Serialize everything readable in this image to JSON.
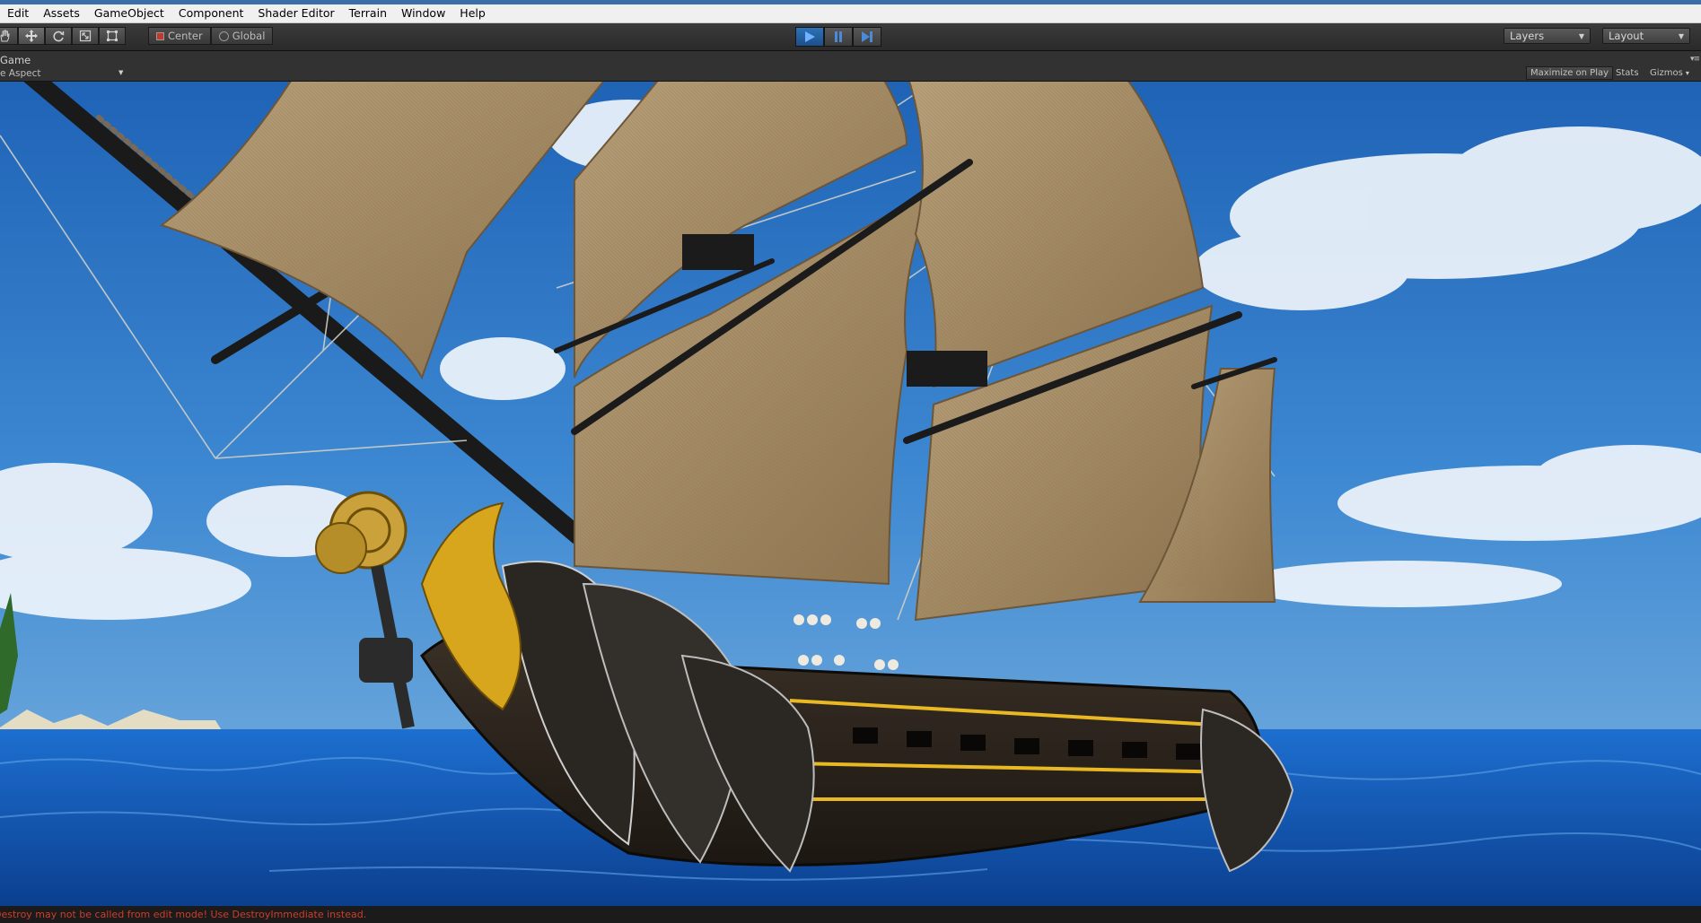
{
  "menubar": {
    "items": [
      "Edit",
      "Assets",
      "GameObject",
      "Component",
      "Shader Editor",
      "Terrain",
      "Window",
      "Help"
    ]
  },
  "toolbar": {
    "transform_tools": [
      "hand-icon",
      "move-icon",
      "rotate-icon",
      "scale-icon",
      "rect-icon"
    ],
    "pivot_mode_label": "Center",
    "pivot_rotation_label": "Global",
    "play_state": "playing",
    "layers_label": "Layers",
    "layout_label": "Layout"
  },
  "game_view": {
    "tab_title": "Game",
    "aspect_label": "e Aspect",
    "maximize_label": "Maximize on Play",
    "stats_label": "Stats",
    "gizmos_label": "Gizmos"
  },
  "console": {
    "message": "Destroy may not be called from edit mode! Use DestroyImmediate instead."
  },
  "colors": {
    "accent_blue": "#2e72b8",
    "error_red": "#d23c2a",
    "sky_blue": "#2f77c4",
    "ocean_blue": "#1256b3",
    "sail_tan": "#a89068",
    "gold_trim": "#e8b923"
  }
}
